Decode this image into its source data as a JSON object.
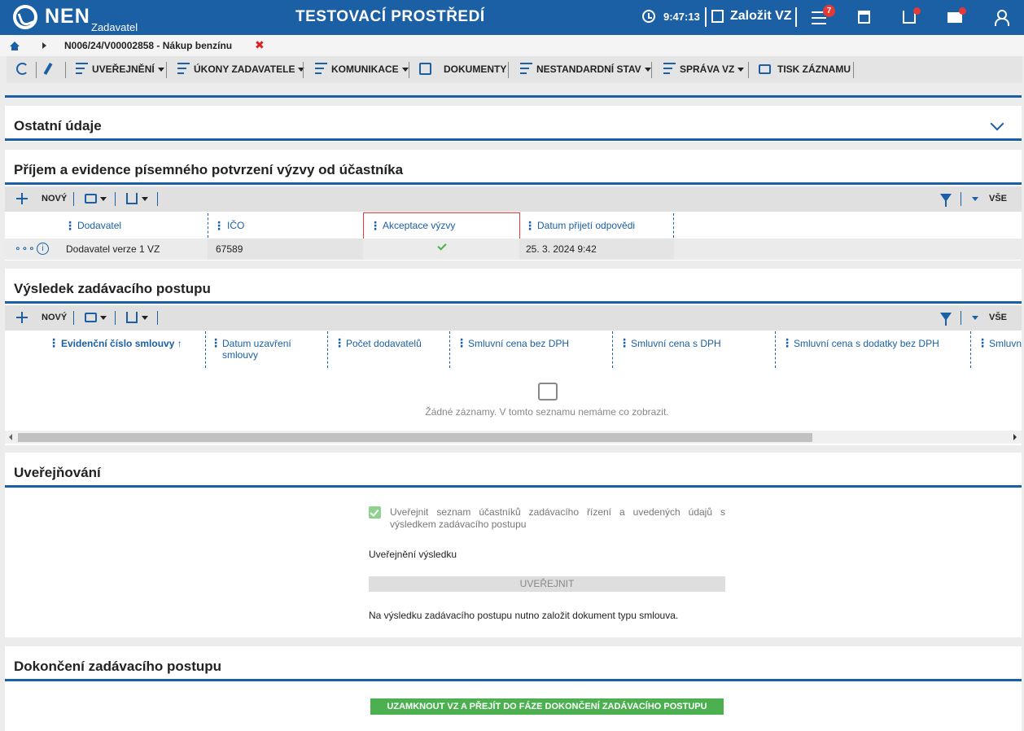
{
  "header": {
    "logo_text": "NEN",
    "logo_sub": "Zadavatel",
    "env_title": "TESTOVACÍ PROSTŘEDÍ",
    "clock": "9:47:13",
    "create_vz": "Založit VZ",
    "notifications_count": "7"
  },
  "breadcrumb": {
    "current": "N006/24/V00002858 - Nákup benzínu"
  },
  "toolbar": {
    "items": [
      {
        "label": "UVEŘEJNĚNÍ"
      },
      {
        "label": "ÚKONY ZADAVATELE"
      },
      {
        "label": "KOMUNIKACE"
      },
      {
        "label": "DOKUMENTY"
      },
      {
        "label": "NESTANDARDNÍ STAV"
      },
      {
        "label": "SPRÁVA VZ"
      },
      {
        "label": "TISK ZÁZNAMU"
      }
    ]
  },
  "sections": {
    "ostatni": {
      "title": "Ostatní údaje"
    },
    "prijem": {
      "title": "Příjem a evidence písemného potvrzení výzvy od účastníka",
      "new_label": "NOVÝ",
      "all_label": "VŠE",
      "columns": [
        "Dodavatel",
        "IČO",
        "Akceptace výzvy",
        "Datum přijetí odpovědi"
      ],
      "rows": [
        {
          "dodavatel": "Dodavatel verze 1 VZ",
          "ico": "67589",
          "akceptace": true,
          "datum": "25. 3. 2024 9:42"
        }
      ]
    },
    "vysledek": {
      "title": "Výsledek zadávacího postupu",
      "new_label": "NOVÝ",
      "all_label": "VŠE",
      "columns": [
        "Evidenční číslo smlouvy",
        "Datum uzavření smlouvy",
        "Počet dodavatelů",
        "Smluvní cena bez DPH",
        "Smluvní cena s DPH",
        "Smluvní cena s dodatky bez DPH",
        "Smluvn"
      ],
      "sort_indicator": "↑",
      "empty_text": "Žádné záznamy. V tomto seznamu nemáme co zobrazit."
    },
    "uverejnovani": {
      "title": "Uveřejňování",
      "checkbox_label": "Uveřejnit seznam účastníků zadávacího řízení a uvedených údajů s výsledkem zadávacího postupu",
      "checkbox_checked": true,
      "sub_label": "Uveřejnění výsledku",
      "button_label": "UVEŘEJNIT",
      "note": "Na výsledku zadávacího postupu nutno založit dokument typu smlouva."
    },
    "dokonceni": {
      "title": "Dokončení zadávacího postupu",
      "button_label": "UZAMKNOUT VZ A PŘEJÍT DO FÁZE DOKONČENÍ ZADÁVACÍHO POSTUPU"
    }
  },
  "colors": {
    "brand_blue": "#1b5fa4",
    "accent_green": "#4caf50",
    "alert_red": "#e53935"
  }
}
